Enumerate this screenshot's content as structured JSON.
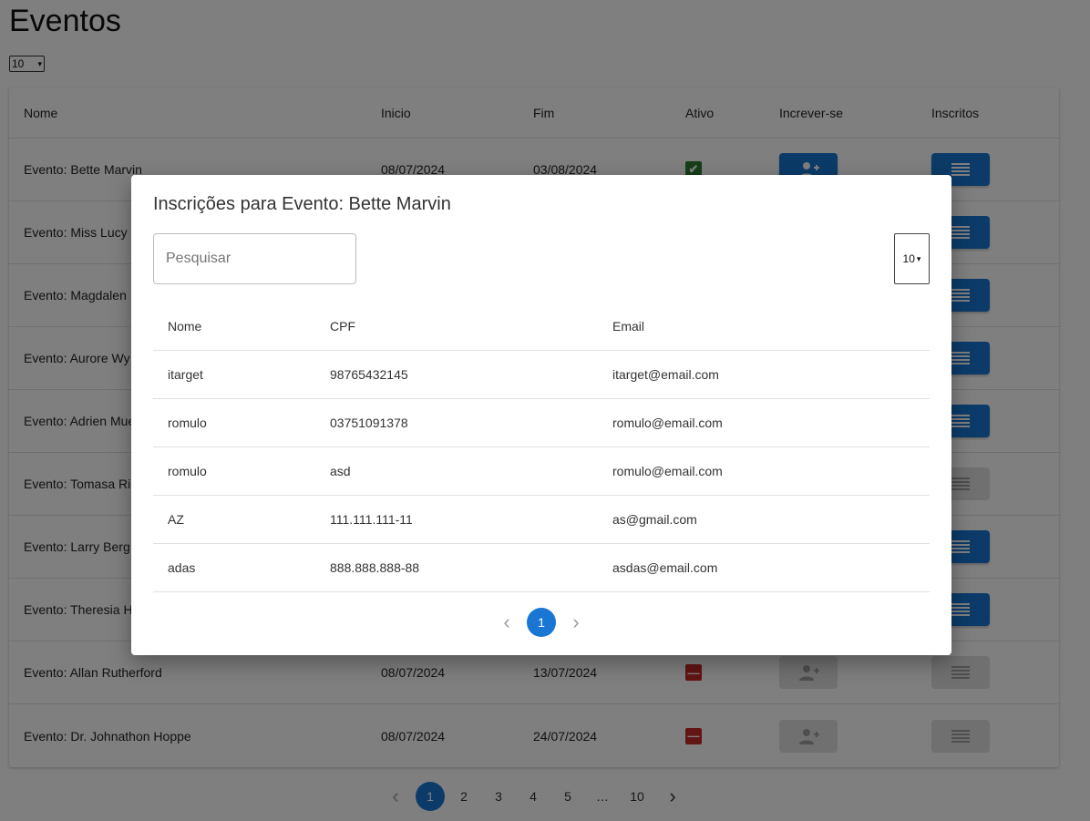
{
  "page": {
    "title": "Eventos",
    "page_size": "10"
  },
  "events_table": {
    "headers": [
      "Nome",
      "Inicio",
      "Fim",
      "Ativo",
      "Increver-se",
      "Inscritos"
    ],
    "rows": [
      {
        "nome": "Evento: Bette Marvin",
        "inicio": "08/07/2024",
        "fim": "03/08/2024",
        "ativo": true,
        "inscrever_enabled": true,
        "inscritos_enabled": true
      },
      {
        "nome": "Evento: Miss Lucy",
        "inicio": "",
        "fim": "",
        "ativo": null,
        "inscrever_enabled": null,
        "inscritos_enabled": true
      },
      {
        "nome": "Evento: Magdalen",
        "inicio": "",
        "fim": "",
        "ativo": null,
        "inscrever_enabled": null,
        "inscritos_enabled": true
      },
      {
        "nome": "Evento: Aurore Wy",
        "inicio": "",
        "fim": "",
        "ativo": null,
        "inscrever_enabled": null,
        "inscritos_enabled": true
      },
      {
        "nome": "Evento: Adrien Mue",
        "inicio": "",
        "fim": "",
        "ativo": null,
        "inscrever_enabled": null,
        "inscritos_enabled": true
      },
      {
        "nome": "Evento: Tomasa Ri",
        "inicio": "",
        "fim": "",
        "ativo": null,
        "inscrever_enabled": null,
        "inscritos_enabled": false
      },
      {
        "nome": "Evento: Larry Berg",
        "inicio": "",
        "fim": "",
        "ativo": null,
        "inscrever_enabled": null,
        "inscritos_enabled": true
      },
      {
        "nome": "Evento: Theresia H",
        "inicio": "",
        "fim": "",
        "ativo": null,
        "inscrever_enabled": null,
        "inscritos_enabled": true
      },
      {
        "nome": "Evento: Allan Rutherford",
        "inicio": "08/07/2024",
        "fim": "13/07/2024",
        "ativo": false,
        "inscrever_enabled": false,
        "inscritos_enabled": false
      },
      {
        "nome": "Evento: Dr. Johnathon Hoppe",
        "inicio": "08/07/2024",
        "fim": "24/07/2024",
        "ativo": false,
        "inscrever_enabled": false,
        "inscritos_enabled": false
      }
    ]
  },
  "pagination": {
    "pages": [
      "1",
      "2",
      "3",
      "4",
      "5",
      "…",
      "10"
    ],
    "current": "1"
  },
  "modal": {
    "title": "Inscrições para Evento: Bette Marvin",
    "search_placeholder": "Pesquisar",
    "search_value": "",
    "page_size": "10",
    "headers": [
      "Nome",
      "CPF",
      "Email"
    ],
    "rows": [
      [
        "itarget",
        "98765432145",
        "itarget@email.com"
      ],
      [
        "romulo",
        "03751091378",
        "romulo@email.com"
      ],
      [
        "romulo",
        "asd",
        "romulo@email.com"
      ],
      [
        "AZ",
        "111.111.111-11",
        "as@gmail.com"
      ],
      [
        "adas",
        "888.888.888-88",
        "asdas@email.com"
      ]
    ],
    "pagination": {
      "pages": [
        "1"
      ],
      "current": "1"
    }
  },
  "colors": {
    "primary": "#1976d2",
    "active_green": "#2e7d32",
    "inactive_red": "#c62828",
    "disabled_gray": "#e0e0e0",
    "overlay": "rgba(0,0,0,0.5)"
  },
  "icons": {
    "add_user": "person-add-icon",
    "list": "list-icon",
    "check": "check-icon",
    "minus": "minus-icon",
    "prev": "chevron-left-icon",
    "next": "chevron-right-icon"
  }
}
